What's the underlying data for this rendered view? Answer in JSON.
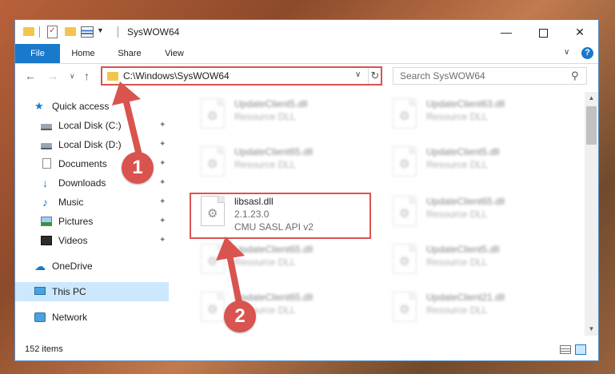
{
  "window": {
    "title": "SysWOW64",
    "controls": {
      "minimize": "—",
      "maximize": "",
      "close": "✕"
    }
  },
  "ribbon": {
    "tabs": [
      "File",
      "Home",
      "Share",
      "View"
    ],
    "help": "?"
  },
  "nav": {
    "address": "C:\\Windows\\SysWOW64",
    "search_placeholder": "Search SysWOW64"
  },
  "sidebar": {
    "items": [
      {
        "label": "Quick access",
        "icon": "star-icon",
        "pinned": false
      },
      {
        "label": "Local Disk (C:)",
        "icon": "drive-icon",
        "pinned": true
      },
      {
        "label": "Local Disk (D:)",
        "icon": "drive-icon",
        "pinned": true
      },
      {
        "label": "Documents",
        "icon": "documents-icon",
        "pinned": true
      },
      {
        "label": "Downloads",
        "icon": "download-icon",
        "pinned": true
      },
      {
        "label": "Music",
        "icon": "music-icon",
        "pinned": true
      },
      {
        "label": "Pictures",
        "icon": "pictures-icon",
        "pinned": true
      },
      {
        "label": "Videos",
        "icon": "videos-icon",
        "pinned": true
      },
      {
        "label": "OneDrive",
        "icon": "cloud-icon",
        "pinned": false
      },
      {
        "label": "This PC",
        "icon": "computer-icon",
        "pinned": false,
        "selected": true
      },
      {
        "label": "Network",
        "icon": "network-icon",
        "pinned": false
      }
    ]
  },
  "files": {
    "left": [
      {
        "name": "UpdateClient5.dll",
        "line1": "Resource DLL",
        "line2": ""
      },
      {
        "name": "UpdateClient65.dll",
        "line1": "Resource DLL",
        "line2": ""
      },
      {
        "name": "libsasl.dll",
        "line1": "2.1.23.0",
        "line2": "CMU SASL API v2"
      },
      {
        "name": "UpdateClient65.dll",
        "line1": "Resource DLL",
        "line2": ""
      },
      {
        "name": "UpdateClient65.dll",
        "line1": "Resource DLL",
        "line2": ""
      }
    ],
    "right": [
      {
        "name": "UpdateClient63.dll",
        "line1": "Resource DLL"
      },
      {
        "name": "UpdateClient5.dll",
        "line1": "Resource DLL"
      },
      {
        "name": "UpdateClient65.dll",
        "line1": "Resource DLL"
      },
      {
        "name": "UpdateClient5.dll",
        "line1": "Resource DLL"
      },
      {
        "name": "UpdateClient21.dll",
        "line1": "Resource DLL"
      }
    ]
  },
  "status": {
    "items": "152 items"
  },
  "annotations": {
    "step1": "1",
    "step2": "2",
    "color": "#d9534f"
  }
}
